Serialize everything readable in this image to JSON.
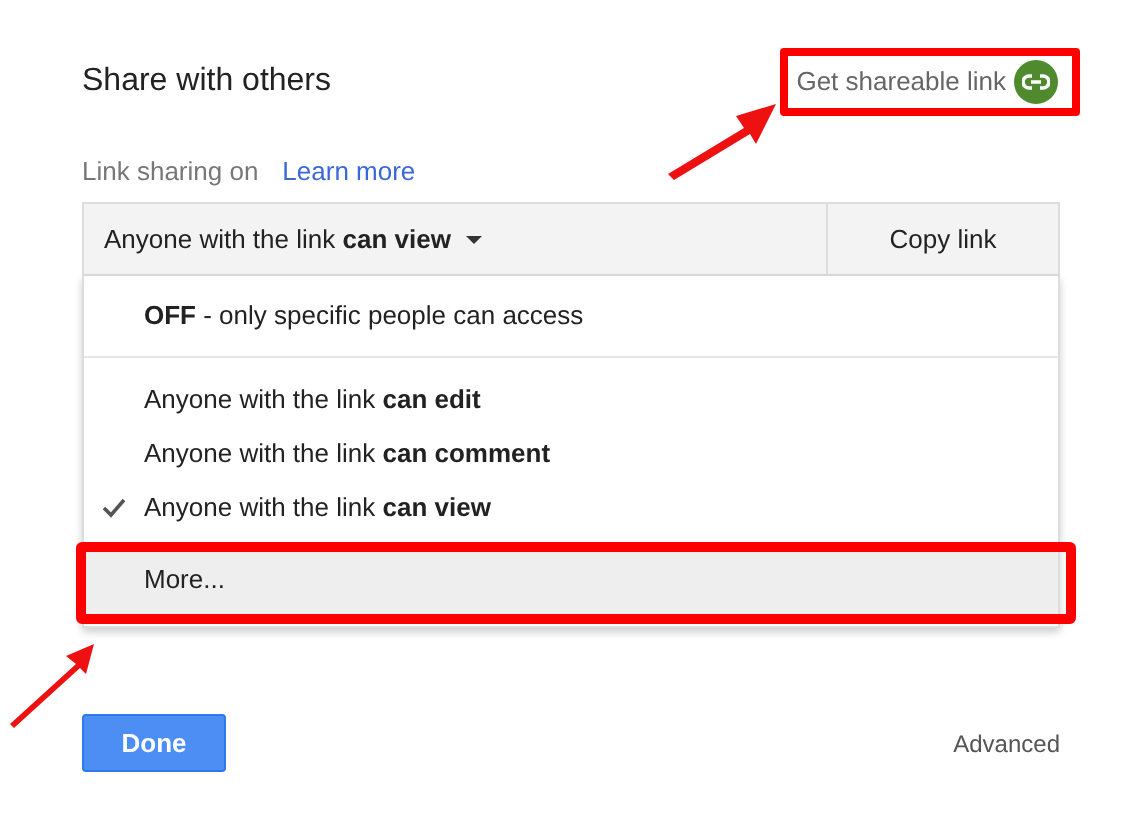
{
  "dialog": {
    "title": "Share with others",
    "shareable_link": "Get shareable link"
  },
  "link_sharing": {
    "label": "Link sharing on",
    "learn_more": "Learn more"
  },
  "access_dropdown": {
    "value": "Anyone with the link **can view**",
    "copy_button": "Copy link"
  },
  "menu": [
    {
      "kind": "option",
      "text": "**OFF** - only specific people can access",
      "checked": false,
      "highlighted": false
    },
    {
      "kind": "divider"
    },
    {
      "kind": "option",
      "text": "Anyone with the link **can edit**",
      "checked": false,
      "highlighted": false
    },
    {
      "kind": "option",
      "text": "Anyone with the link **can comment**",
      "checked": false,
      "highlighted": false
    },
    {
      "kind": "option",
      "text": "Anyone with the link **can view**",
      "checked": true,
      "highlighted": false
    },
    {
      "kind": "option",
      "text": "More...",
      "checked": false,
      "highlighted": true
    }
  ],
  "footer": {
    "done": "Done",
    "advanced": "Advanced"
  }
}
